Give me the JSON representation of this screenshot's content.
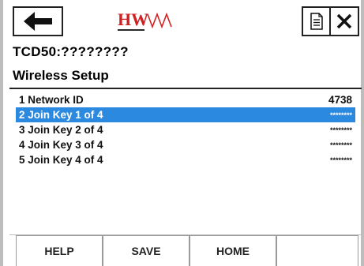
{
  "topbar": {
    "back_icon": "left-arrow-icon",
    "logo_icon": "hw-logo-icon",
    "logo_text": "HW",
    "document_icon": "document-icon",
    "close_icon": "close-icon"
  },
  "device_title": "TCD50:????????",
  "section_title": "Wireless Setup",
  "list": {
    "items": [
      {
        "label": "1 Network ID",
        "value": "4738",
        "selected": false
      },
      {
        "label": "2 Join Key 1 of 4",
        "value": "********",
        "selected": true
      },
      {
        "label": "3 Join Key 2 of 4",
        "value": "********",
        "selected": false
      },
      {
        "label": "4 Join Key 3 of 4",
        "value": "********",
        "selected": false
      },
      {
        "label": "5 Join Key 4 of 4",
        "value": "********",
        "selected": false
      }
    ]
  },
  "bottombar": {
    "help_label": "HELP",
    "save_label": "SAVE",
    "home_label": "HOME",
    "fourth_label": ""
  },
  "colors": {
    "selection": "#2b8ae0",
    "logo_red": "#d22020"
  }
}
